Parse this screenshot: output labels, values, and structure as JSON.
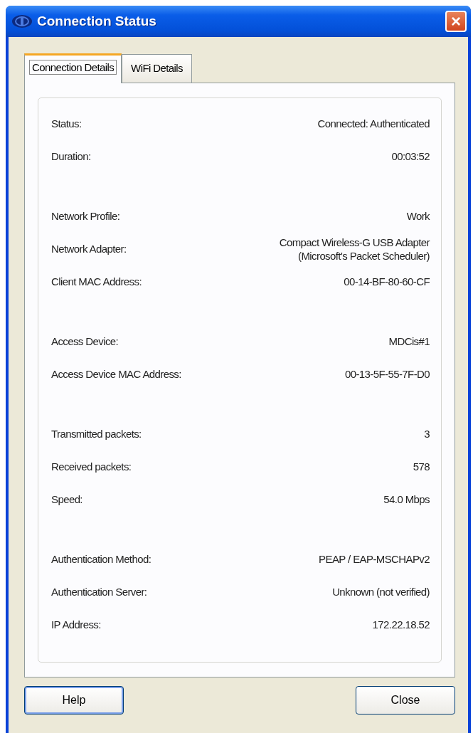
{
  "window": {
    "title": "Connection Status",
    "close": "×"
  },
  "tabs": [
    {
      "label": "Connection Details",
      "selected": true
    },
    {
      "label": "WiFi Details",
      "selected": false
    }
  ],
  "groups": [
    [
      {
        "label": "Status:",
        "value": "Connected: Authenticated"
      },
      {
        "label": "Duration:",
        "value": "00:03:52"
      }
    ],
    [
      {
        "label": "Network Profile:",
        "value": "Work"
      },
      {
        "label": "Network Adapter:",
        "value": "Compact Wireless-G USB Adapter\n(Microsoft's Packet Scheduler)"
      },
      {
        "label": "Client MAC Address:",
        "value": "00-14-BF-80-60-CF"
      }
    ],
    [
      {
        "label": "Access Device:",
        "value": "MDCis#1"
      },
      {
        "label": "Access Device MAC Address:",
        "value": "00-13-5F-55-7F-D0"
      }
    ],
    [
      {
        "label": "Transmitted packets:",
        "value": "3"
      },
      {
        "label": "Received packets:",
        "value": "578"
      },
      {
        "label": "Speed:",
        "value": "54.0 Mbps"
      }
    ],
    [
      {
        "label": "Authentication Method:",
        "value": "PEAP / EAP-MSCHAPv2"
      },
      {
        "label": "Authentication Server:",
        "value": "Unknown (not verified)"
      },
      {
        "label": "IP Address:",
        "value": "172.22.18.52"
      }
    ]
  ],
  "buttons": [
    {
      "label": "Help",
      "default": true
    },
    {
      "label": "Close",
      "default": false
    }
  ]
}
